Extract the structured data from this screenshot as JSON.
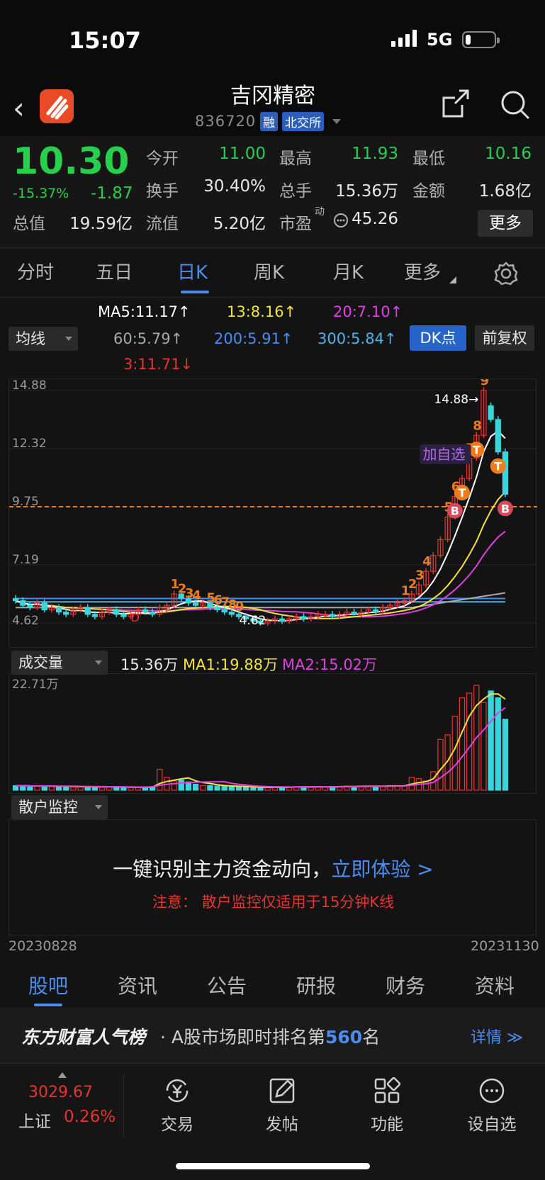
{
  "status_bar": {
    "time": "15:07",
    "network": "5G"
  },
  "header": {
    "title": "吉冈精密",
    "code": "836720",
    "badge1": "融",
    "badge2": "北交所"
  },
  "quote": {
    "price": "10.30",
    "change_pct": "-15.37%",
    "change": "-1.87",
    "open_label": "今开",
    "open": "11.00",
    "high_label": "最高",
    "high": "11.93",
    "low_label": "最低",
    "low": "10.16",
    "turnover_label": "换手",
    "turnover": "30.40%",
    "volume_label": "总手",
    "volume": "15.36万",
    "amount_label": "金额",
    "amount": "1.68亿",
    "mcap_label": "总值",
    "mcap": "19.59亿",
    "float_label": "流值",
    "float": "5.20亿",
    "pe_label": "市盈",
    "pe_sup": "动",
    "pe": "45.26",
    "more_button": "更多"
  },
  "tabs": [
    "分时",
    "五日",
    "日K",
    "周K",
    "月K",
    "更多"
  ],
  "active_tab": "日K",
  "ma": {
    "ma5": "MA5:11.17↑",
    "ma13": "13:8.16↑",
    "ma20": "20:7.10↑",
    "dropdown": "均线",
    "ma60": "60:5.79↑",
    "ma200": "200:5.91↑",
    "ma300": "300:5.84↑",
    "dk_button": "DK点",
    "fq_button": "前复权",
    "ma3": "3:11.71↓"
  },
  "chart_data": {
    "type": "candlestick",
    "y_ticks": [
      "14.88",
      "12.32",
      "9.75",
      "7.19",
      "4.62"
    ],
    "ylim": [
      4.62,
      14.88
    ],
    "max_label": "14.88→",
    "min_label": "4.62",
    "watch_label": "加自选",
    "ref_line": 9.75,
    "series": [
      {
        "name": "MA5",
        "color": "#ffffff"
      },
      {
        "name": "MA13",
        "color": "#f2e33a"
      },
      {
        "name": "MA20",
        "color": "#e23ee6"
      },
      {
        "name": "MA60",
        "color": "#a9a9a9"
      },
      {
        "name": "MA200",
        "color": "#4a8df0"
      },
      {
        "name": "MA300",
        "color": "#4fb3e8"
      }
    ],
    "closes": [
      5.6,
      5.4,
      5.3,
      5.5,
      5.2,
      5.3,
      5.1,
      5.0,
      5.2,
      5.3,
      5.0,
      4.9,
      5.1,
      5.2,
      5.0,
      4.9,
      5.0,
      5.2,
      5.1,
      5.0,
      5.3,
      5.4,
      5.9,
      5.7,
      5.5,
      5.4,
      5.5,
      5.3,
      5.2,
      5.1,
      5.0,
      4.9,
      4.8,
      4.7,
      4.62,
      4.7,
      4.8,
      4.7,
      4.8,
      4.9,
      4.8,
      4.9,
      5.0,
      5.0,
      4.9,
      5.0,
      5.1,
      5.0,
      5.1,
      5.2,
      5.1,
      5.3,
      5.4,
      5.5,
      5.6,
      5.9,
      6.3,
      6.9,
      7.6,
      8.3,
      9.3,
      10.2,
      11.0,
      11.9,
      12.9,
      14.88,
      13.6,
      12.17,
      10.3
    ],
    "opens": [
      5.7,
      5.6,
      5.4,
      5.3,
      5.5,
      5.2,
      5.3,
      5.1,
      5.0,
      5.2,
      5.3,
      5.0,
      4.9,
      5.1,
      5.2,
      5.0,
      4.9,
      5.0,
      5.2,
      5.1,
      5.0,
      5.2,
      5.4,
      5.9,
      5.7,
      5.5,
      5.4,
      5.5,
      5.3,
      5.2,
      5.1,
      5.0,
      4.9,
      4.8,
      4.7,
      4.62,
      4.7,
      4.8,
      4.7,
      4.8,
      4.9,
      4.8,
      4.9,
      5.0,
      5.0,
      4.9,
      5.0,
      5.1,
      5.0,
      5.1,
      5.2,
      5.1,
      5.3,
      5.4,
      5.5,
      5.6,
      5.9,
      6.3,
      6.9,
      7.6,
      8.3,
      9.3,
      10.2,
      11.0,
      11.9,
      12.9,
      14.2,
      13.6,
      12.17
    ],
    "signals": [
      {
        "label": "1",
        "i": 22
      },
      {
        "label": "2",
        "i": 23
      },
      {
        "label": "3",
        "i": 24
      },
      {
        "label": "4",
        "i": 25
      },
      {
        "label": "5",
        "i": 27
      },
      {
        "label": "6",
        "i": 28
      },
      {
        "label": "7",
        "i": 29
      },
      {
        "label": "8",
        "i": 30
      },
      {
        "label": "9",
        "i": 31
      },
      {
        "label": "1",
        "i": 54
      },
      {
        "label": "2",
        "i": 55
      },
      {
        "label": "3",
        "i": 56
      },
      {
        "label": "4",
        "i": 57
      },
      {
        "label": "5",
        "i": 60
      },
      {
        "label": "6",
        "i": 61
      },
      {
        "label": "7",
        "i": 63
      },
      {
        "label": "8",
        "i": 64
      },
      {
        "label": "9",
        "i": 65
      }
    ],
    "points": [
      {
        "label": "B",
        "i": 61
      },
      {
        "label": "T",
        "i": 62
      },
      {
        "label": "T",
        "i": 64
      },
      {
        "label": "T",
        "i": 67
      },
      {
        "label": "B",
        "i": 68
      }
    ],
    "extra_marks": [
      "D"
    ]
  },
  "volume": {
    "dropdown": "成交量",
    "total": "15.36万",
    "ma1": "MA1:19.88万",
    "ma2": "MA2:15.02万",
    "max_label": "22.71万",
    "values": [
      1.0,
      1.0,
      0.8,
      0.9,
      0.9,
      0.8,
      0.8,
      0.8,
      0.7,
      0.7,
      0.8,
      0.7,
      0.7,
      0.8,
      0.7,
      0.6,
      0.6,
      0.6,
      0.7,
      0.8,
      4.5,
      2.8,
      2.0,
      2.2,
      1.8,
      1.3,
      1.0,
      1.0,
      0.9,
      0.9,
      0.8,
      0.7,
      0.7,
      0.6,
      0.6,
      0.6,
      0.7,
      0.7,
      0.7,
      0.8,
      0.7,
      0.7,
      0.8,
      0.7,
      0.8,
      0.8,
      0.9,
      0.8,
      0.9,
      0.9,
      0.8,
      0.9,
      1.0,
      1.0,
      1.0,
      2.8,
      2.5,
      2.0,
      4.0,
      11.0,
      12.0,
      16.0,
      20.0,
      21.0,
      22.71,
      19.0,
      21.5,
      20.0,
      15.36
    ]
  },
  "retail": {
    "dropdown": "散户监控",
    "promo_text": "一键识别主力资金动向，",
    "promo_link": "立即体验 >",
    "note": "注意：  散户监控仅适用于15分钟K线",
    "date_start": "20230828",
    "date_end": "20231130"
  },
  "bottom_tabs": [
    "股吧",
    "资讯",
    "公告",
    "研报",
    "财务",
    "资料"
  ],
  "rank": {
    "brand": "东方财富人气榜",
    "text_before": "· A股市场即时排名第",
    "rank": "560",
    "text_after": "名",
    "detail": "详情 ≫"
  },
  "footer": {
    "index_value": "3029.67",
    "index_name": "上证",
    "index_pct": "0.26%",
    "trade": "交易",
    "post": "发帖",
    "function": "功能",
    "watchlist": "设自选"
  },
  "colors": {
    "up": "#e8332f",
    "down": "#26d04c",
    "accent": "#4a8df0",
    "cyan": "#3ad4dc",
    "orange": "#f07b1a"
  }
}
